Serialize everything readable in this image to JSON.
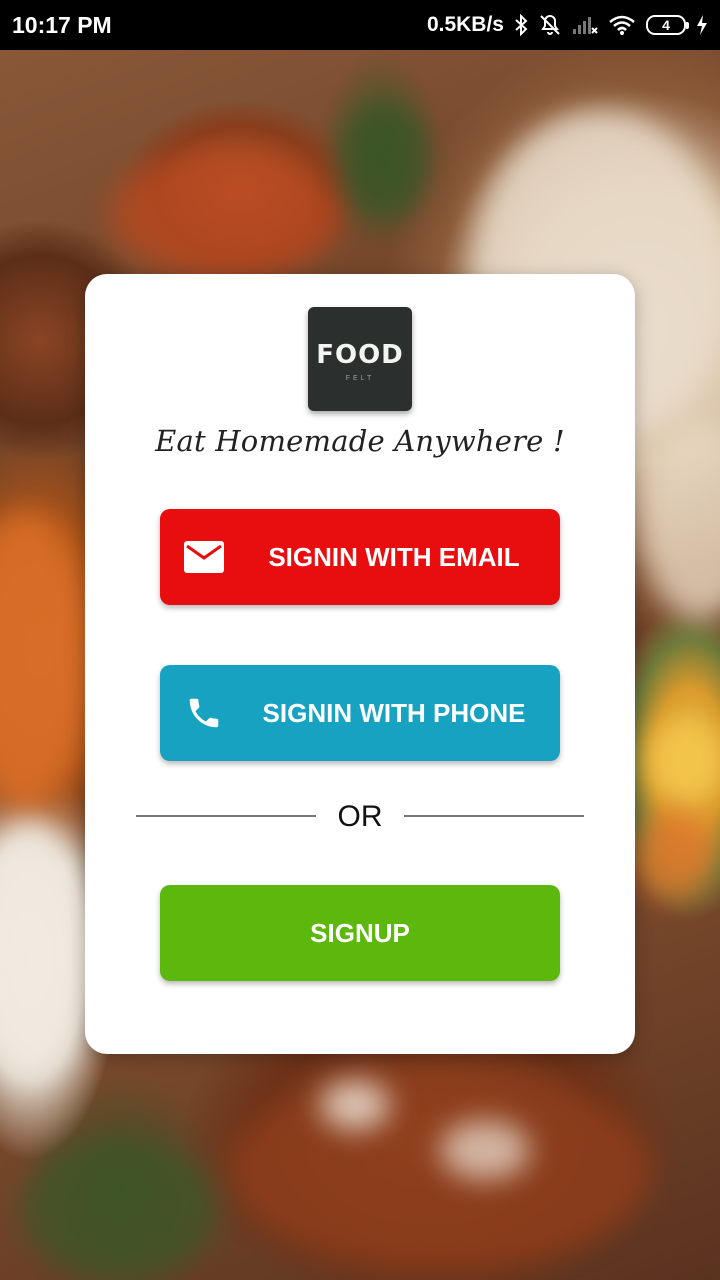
{
  "status_bar": {
    "time": "10:17 PM",
    "network_speed": "0.5KB/s",
    "battery_level": "4",
    "icons": [
      "bluetooth-icon",
      "mute-icon",
      "signal-icon",
      "wifi-icon",
      "battery-icon",
      "charging-icon"
    ]
  },
  "logo": {
    "text": "FOOD",
    "subtext": "FELT"
  },
  "tagline": "Eat Homemade Anywhere !",
  "buttons": {
    "email": {
      "label": "SIGNIN WITH EMAIL",
      "icon": "mail-icon",
      "color": "#e80d0f"
    },
    "phone": {
      "label": "SIGNIN WITH PHONE",
      "icon": "phone-icon",
      "color": "#17a2c2"
    },
    "signup": {
      "label": "SIGNUP",
      "color": "#5cb80c"
    }
  },
  "divider_text": "OR"
}
